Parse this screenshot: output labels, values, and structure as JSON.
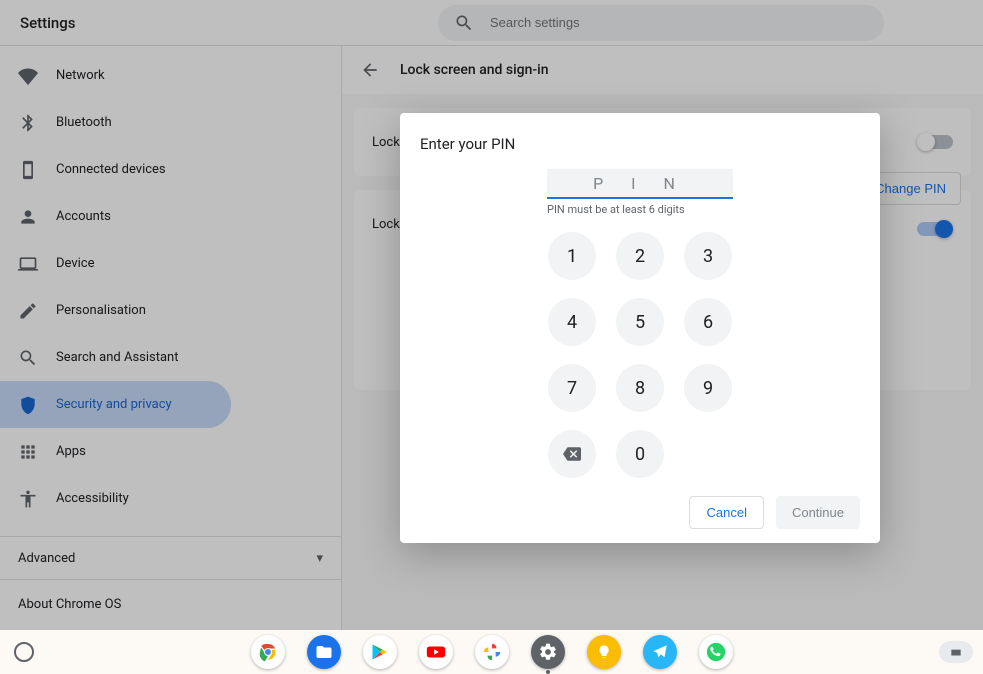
{
  "header": {
    "title": "Settings",
    "search_placeholder": "Search settings"
  },
  "sidebar": {
    "items": [
      {
        "label": "Network"
      },
      {
        "label": "Bluetooth"
      },
      {
        "label": "Connected devices"
      },
      {
        "label": "Accounts"
      },
      {
        "label": "Device"
      },
      {
        "label": "Personalisation"
      },
      {
        "label": "Search and Assistant"
      },
      {
        "label": "Security and privacy"
      },
      {
        "label": "Apps"
      },
      {
        "label": "Accessibility"
      }
    ],
    "advanced": "Advanced",
    "about": "About Chrome OS"
  },
  "content": {
    "page_title": "Lock screen and sign-in",
    "row1": "Lock w",
    "row2": "Lock s",
    "change_pin": "Change PIN"
  },
  "dialog": {
    "title": "Enter your PIN",
    "placeholder": "P I N",
    "hint": "PIN must be at least 6 digits",
    "keys": [
      "1",
      "2",
      "3",
      "4",
      "5",
      "6",
      "7",
      "8",
      "9",
      "0"
    ],
    "cancel": "Cancel",
    "continue": "Continue"
  },
  "shelf": {
    "apps": [
      {
        "name": "chrome",
        "bg": "#fff"
      },
      {
        "name": "files",
        "bg": "#1a73e8"
      },
      {
        "name": "play-store",
        "bg": "#fff"
      },
      {
        "name": "youtube",
        "bg": "#fff"
      },
      {
        "name": "photos",
        "bg": "#fff"
      },
      {
        "name": "settings",
        "bg": "#5f6368",
        "active": true
      },
      {
        "name": "keep",
        "bg": "#fbbc04"
      },
      {
        "name": "telegram",
        "bg": "#29b6f6"
      },
      {
        "name": "whatsapp",
        "bg": "#25d366"
      }
    ]
  }
}
